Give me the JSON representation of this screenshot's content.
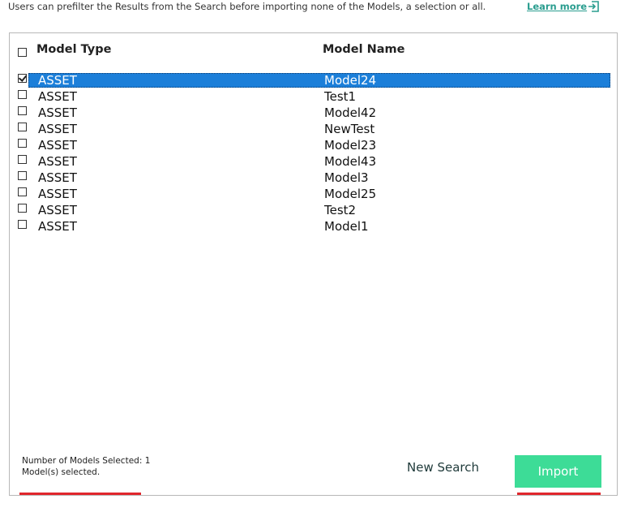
{
  "header": {
    "description": "Users can prefilter the Results from the Search before importing none of the Models, a selection or all.",
    "learn_more": "Learn more",
    "learn_more_icon": "external-arrow-icon"
  },
  "table": {
    "columns": {
      "type": "Model Type",
      "name": "Model Name"
    },
    "select_all_checked": false,
    "rows": [
      {
        "type": "ASSET",
        "name": "Model24",
        "checked": true,
        "selected": true
      },
      {
        "type": "ASSET",
        "name": "Test1",
        "checked": false,
        "selected": false
      },
      {
        "type": "ASSET",
        "name": "Model42",
        "checked": false,
        "selected": false
      },
      {
        "type": "ASSET",
        "name": "NewTest",
        "checked": false,
        "selected": false
      },
      {
        "type": "ASSET",
        "name": "Model23",
        "checked": false,
        "selected": false
      },
      {
        "type": "ASSET",
        "name": "Model43",
        "checked": false,
        "selected": false
      },
      {
        "type": "ASSET",
        "name": "Model3",
        "checked": false,
        "selected": false
      },
      {
        "type": "ASSET",
        "name": "Model25",
        "checked": false,
        "selected": false
      },
      {
        "type": "ASSET",
        "name": "Test2",
        "checked": false,
        "selected": false
      },
      {
        "type": "ASSET",
        "name": "Model1",
        "checked": false,
        "selected": false
      }
    ]
  },
  "footer": {
    "status": "Number of Models Selected: 1 Model(s) selected.",
    "new_search_label": "New Search",
    "import_label": "Import"
  },
  "colors": {
    "accent": "#3ddc97",
    "selection": "#1c7fd9",
    "link": "#2a9d8f",
    "underline_marker": "#e0262c"
  }
}
